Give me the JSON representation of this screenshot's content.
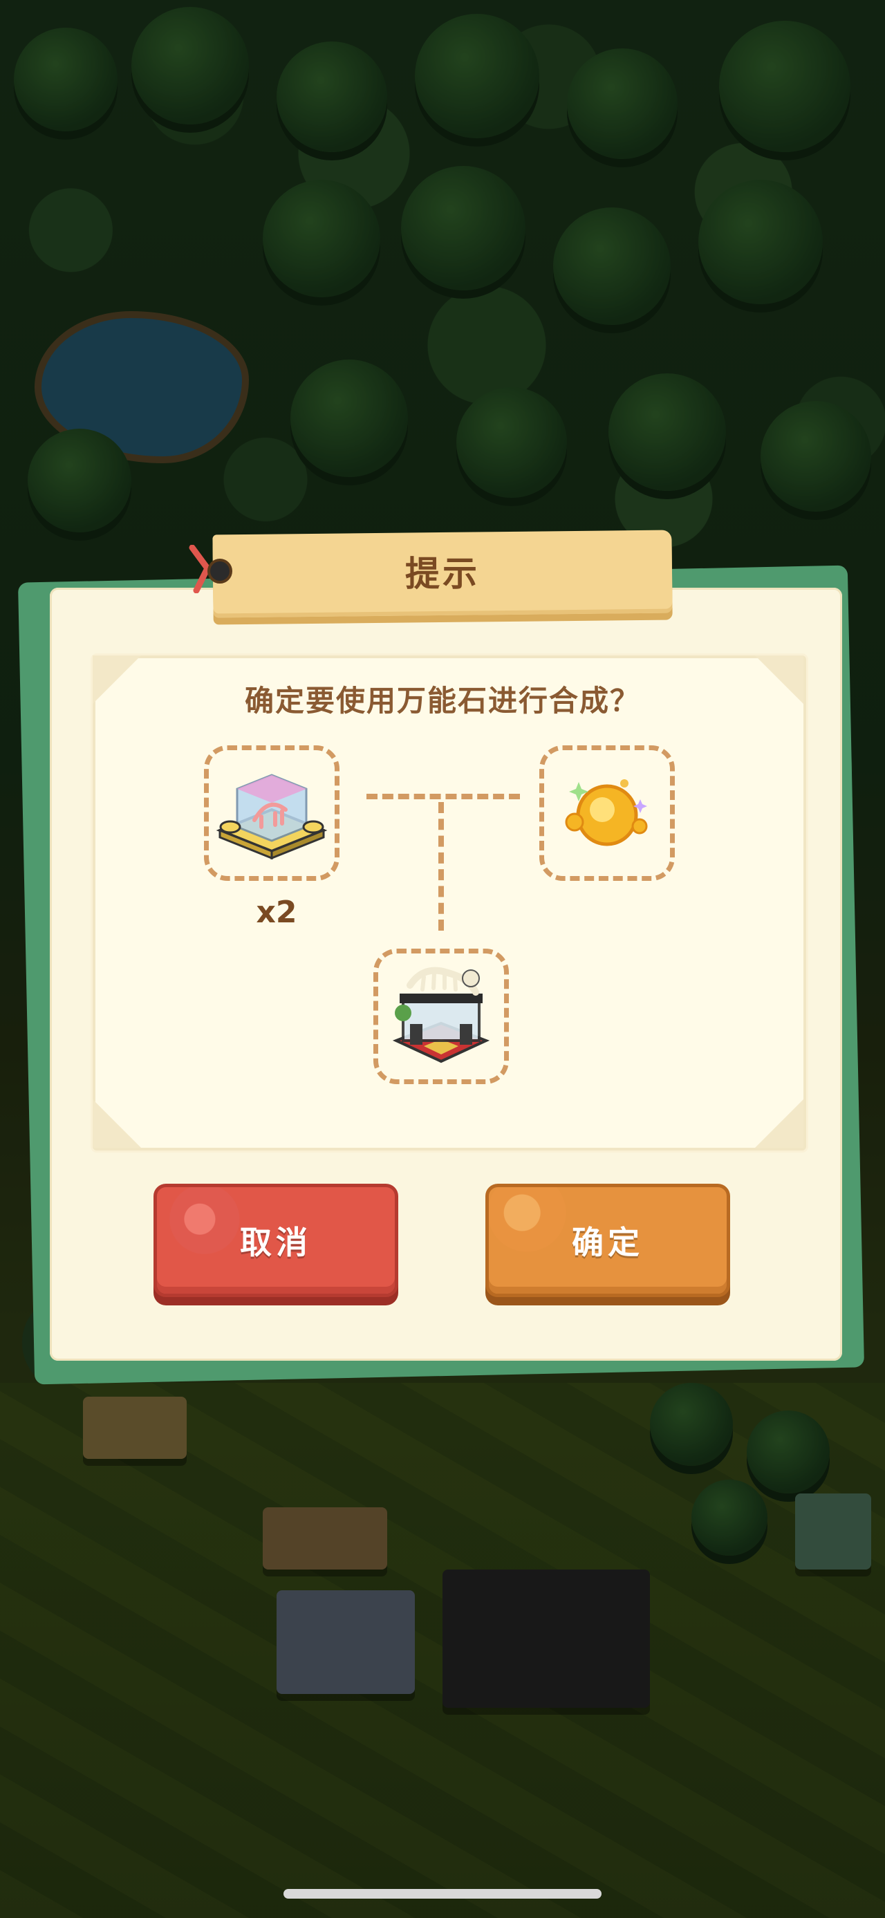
{
  "dialog": {
    "title": "提示",
    "question": "确定要使用万能石进行合成？",
    "inputs": [
      {
        "item": "dino-fossil-display-icon",
        "quantity": "x2"
      },
      {
        "item": "universal-stone-icon"
      }
    ],
    "result": {
      "item": "dinosaur-skeleton-exhibit-icon"
    },
    "buttons": {
      "cancel_label": "取消",
      "confirm_label": "确定"
    }
  },
  "colors": {
    "panel": "#fbf6df",
    "panel_back": "#4f9a6e",
    "title_banner": "#f4d592",
    "title_text": "#7a4a22",
    "question_text": "#8a5a32",
    "slot_border": "#d29a62",
    "cancel_button": "#e15748",
    "confirm_button": "#e6923e"
  }
}
